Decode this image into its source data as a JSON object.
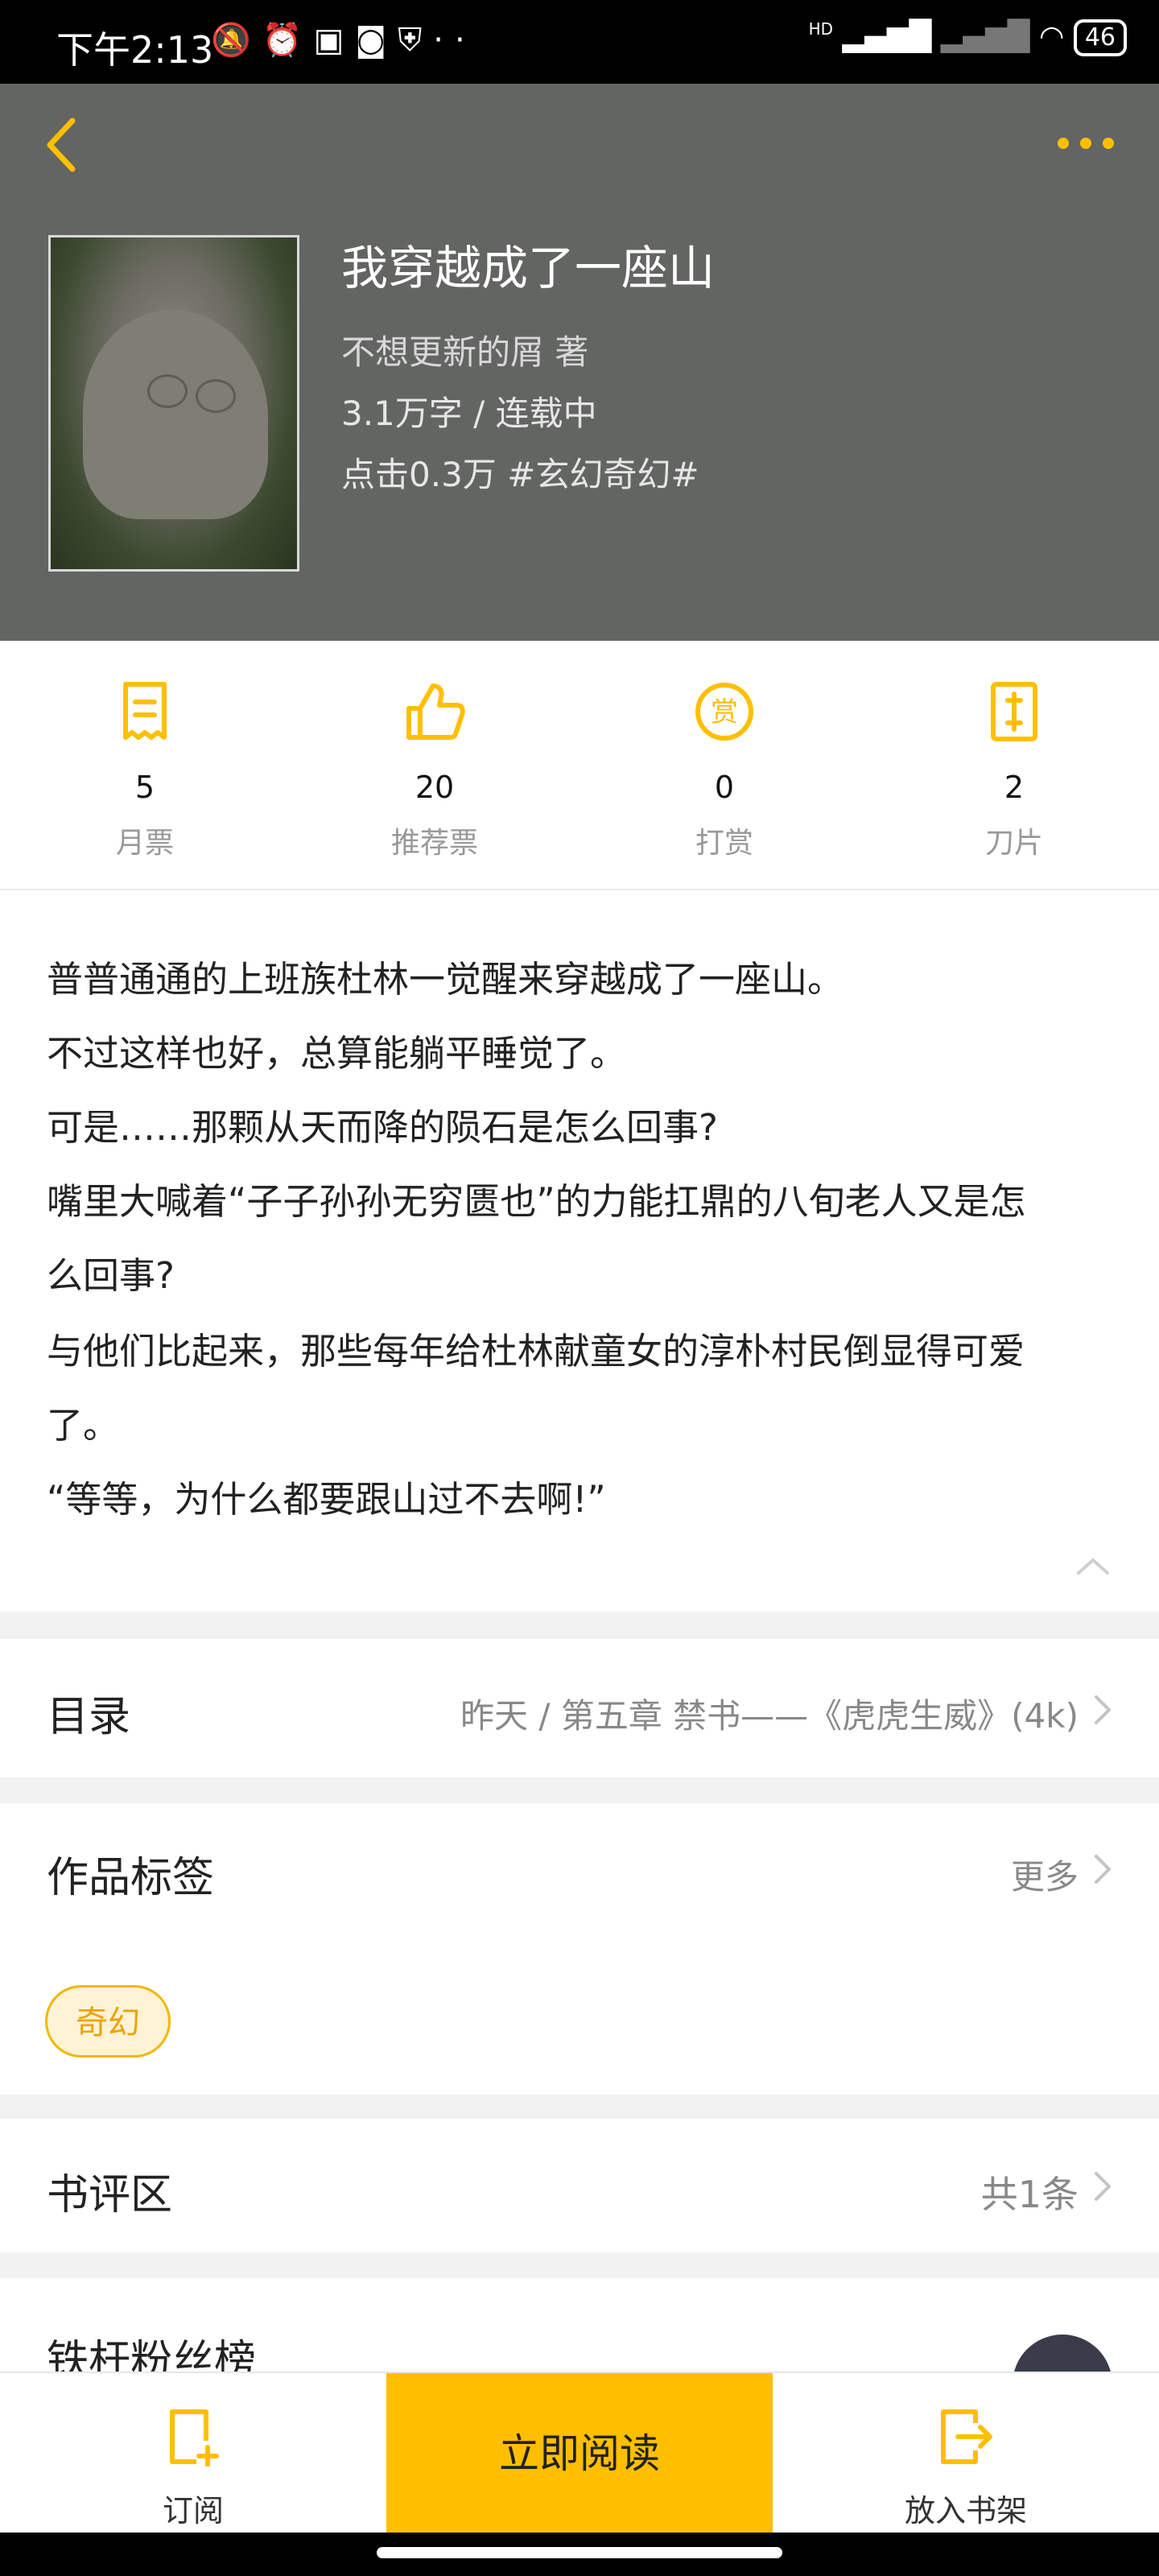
{
  "status_bar": {
    "time": "下午2:13",
    "left_icons": [
      "mute-bell-icon",
      "alarm-icon",
      "app-icon",
      "app-icon",
      "shield-icon",
      "more-dots-icon"
    ],
    "network": "HD",
    "battery": "46"
  },
  "header": {
    "title": "我穿越成了一座山",
    "author": "不想更新的屑  著",
    "word_status": "3.1万字 / 连载中",
    "clicks_genre": "点击0.3万  #玄幻奇幻#"
  },
  "stats": [
    {
      "value": "5",
      "label": "月票",
      "icon": "receipt-icon"
    },
    {
      "value": "20",
      "label": "推荐票",
      "icon": "thumbs-up-icon"
    },
    {
      "value": "0",
      "label": "打赏",
      "icon": "reward-icon"
    },
    {
      "value": "2",
      "label": "刀片",
      "icon": "blade-icon"
    }
  ],
  "synopsis": {
    "lines": [
      "普普通通的上班族杜林一觉醒来穿越成了一座山。",
      "不过这样也好，总算能躺平睡觉了。",
      "可是……那颗从天而降的陨石是怎么回事?",
      "嘴里大喊着“子子孙孙无穷匮也”的力能扛鼎的八旬老人又是怎",
      "么回事?",
      "与他们比起来，那些每年给杜林献童女的淳朴村民倒显得可爱",
      "了。",
      "“等等，为什么都要跟山过不去啊!”"
    ]
  },
  "catalog": {
    "title": "目录",
    "latest": "昨天 / 第五章 禁书——《虎虎生威》(4k)"
  },
  "tags_section": {
    "title": "作品标签",
    "more": "更多",
    "tags": [
      "奇幻"
    ]
  },
  "reviews": {
    "title": "书评区",
    "count": "共1条"
  },
  "fans": {
    "title": "铁杆粉丝榜"
  },
  "bottom_bar": {
    "subscribe": "订阅",
    "read_now": "立即阅读",
    "add_shelf": "放入书架"
  },
  "colors": {
    "accent": "#ffbf00",
    "header_bg": "#636563"
  }
}
